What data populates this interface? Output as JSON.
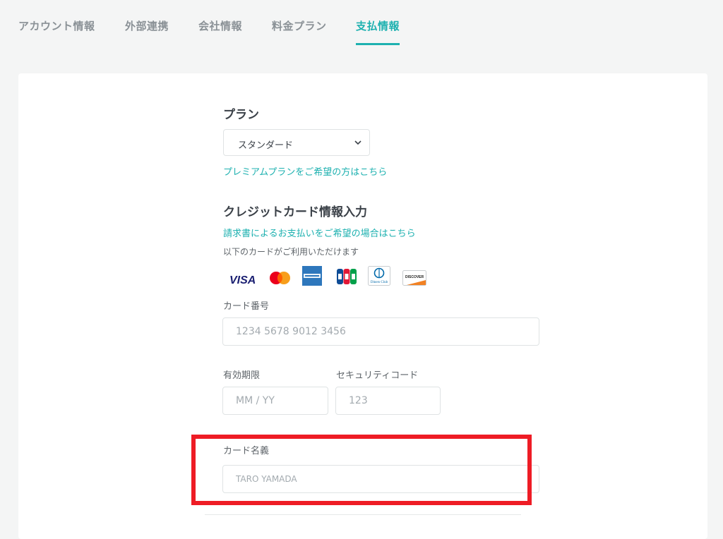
{
  "tabs": [
    {
      "label": "アカウント情報"
    },
    {
      "label": "外部連携"
    },
    {
      "label": "会社情報"
    },
    {
      "label": "料金プラン"
    },
    {
      "label": "支払情報",
      "active": true
    }
  ],
  "plan": {
    "heading": "プラン",
    "selected": "スタンダード",
    "premium_link": "プレミアムプランをご希望の方はこちら"
  },
  "credit": {
    "heading": "クレジットカード情報入力",
    "invoice_link": "請求書によるお支払いをご希望の場合はこちら",
    "accepted_note": "以下のカードがご利用いただけます",
    "brands": [
      "visa-icon",
      "mastercard-icon",
      "amex-icon",
      "jcb-icon",
      "diners-club-icon",
      "discover-icon"
    ],
    "brand_text": {
      "visa": "VISA",
      "discover": "DISCOVER",
      "diners": "Diners Club"
    }
  },
  "fields": {
    "card_number": {
      "label": "カード番号",
      "placeholder": "1234 5678 9012 3456"
    },
    "expiry": {
      "label": "有効期限",
      "placeholder": "MM / YY"
    },
    "cvc": {
      "label": "セキュリティコード",
      "placeholder": "123"
    },
    "card_name": {
      "label": "カード名義",
      "placeholder": "TARO YAMADA"
    }
  },
  "colors": {
    "accent": "#1eb1b0",
    "highlight": "#ee1c25",
    "background": "#f4f5f5"
  }
}
